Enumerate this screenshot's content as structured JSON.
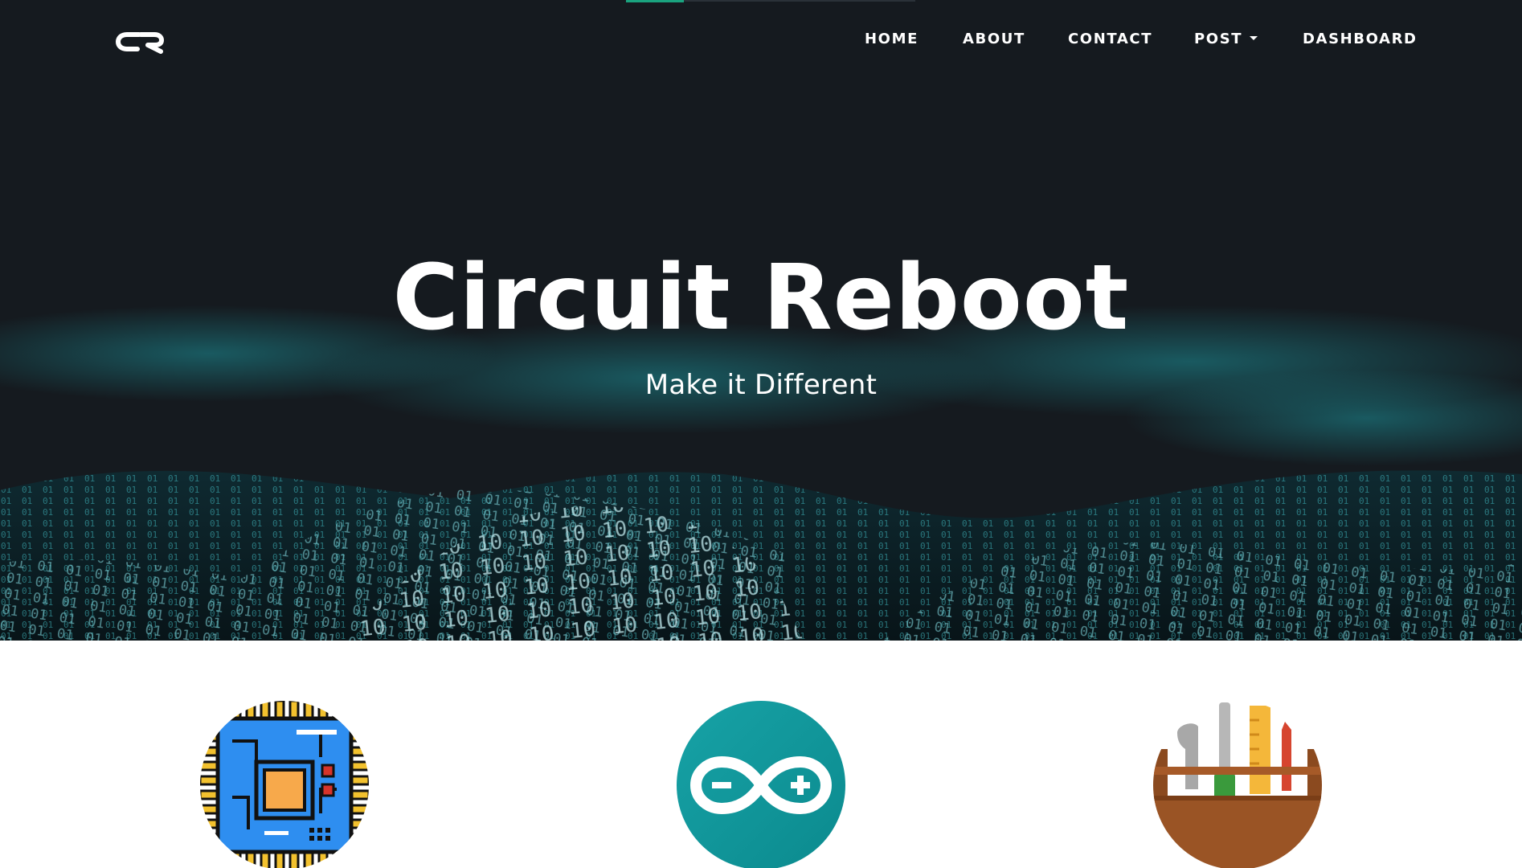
{
  "brand": {
    "logo_text": "CR"
  },
  "nav": {
    "items": [
      {
        "label": "HOME"
      },
      {
        "label": "ABOUT"
      },
      {
        "label": "CONTACT"
      },
      {
        "label": "POST"
      },
      {
        "label": "DASHBOARD"
      }
    ]
  },
  "hero": {
    "title": "Circuit Reboot",
    "subtitle": "Make it Different"
  },
  "features": {
    "icons": [
      "circuit-board-icon",
      "arduino-infinity-icon",
      "toolbox-icon"
    ]
  },
  "colors": {
    "background_dark": "#151a1f",
    "accent_teal": "#1aa3a8",
    "loader_green": "#1aa37f",
    "text_white": "#ffffff"
  }
}
